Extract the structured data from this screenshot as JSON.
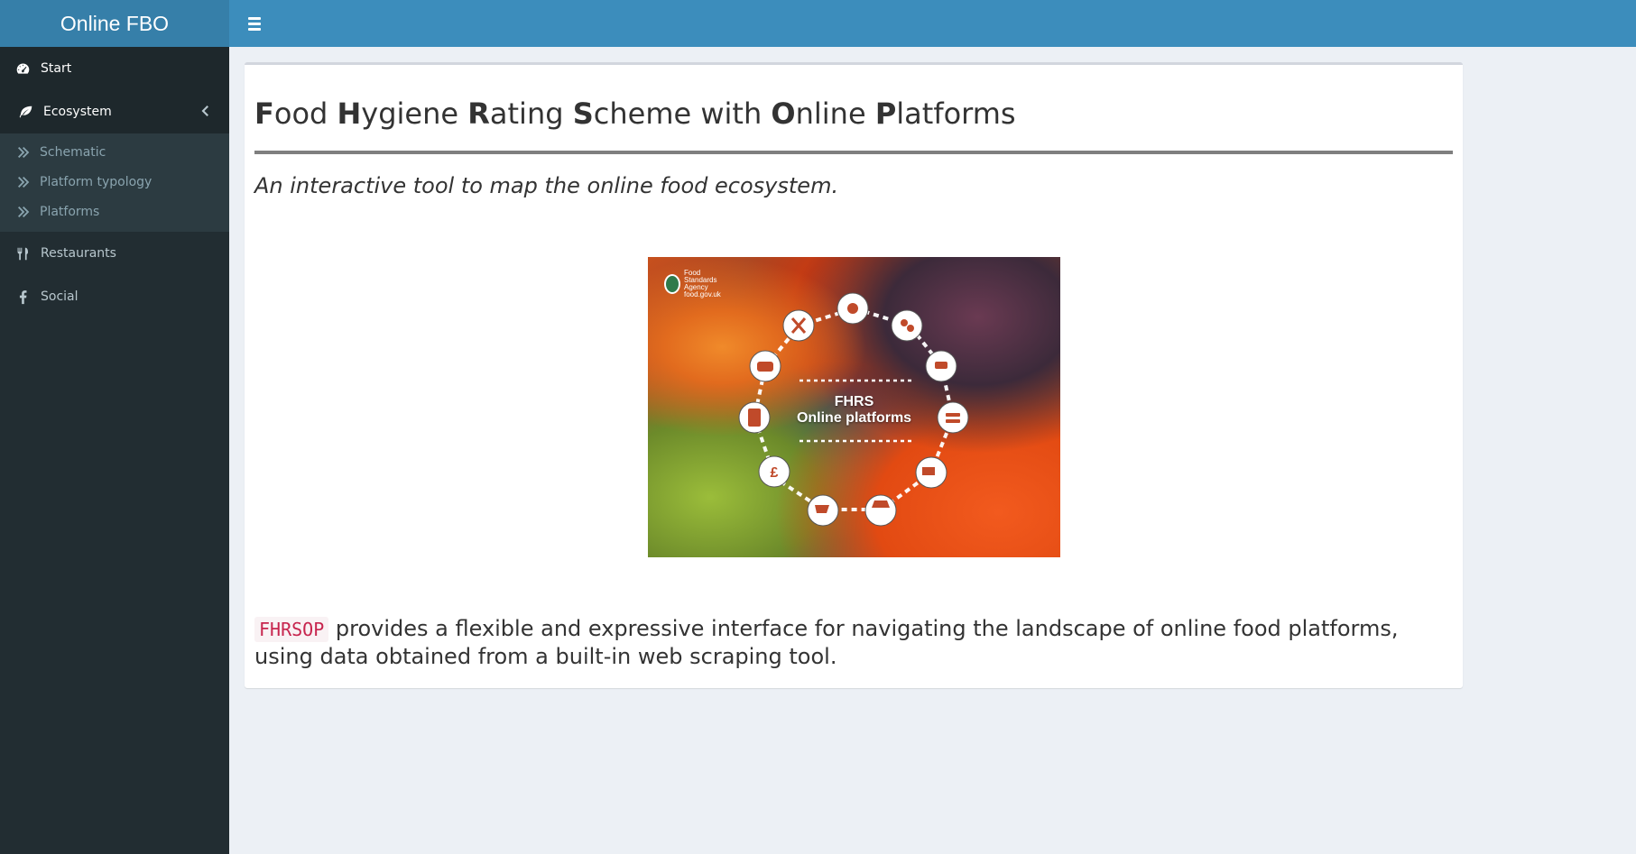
{
  "app": {
    "title": "Online FBO"
  },
  "sidebar": {
    "items": [
      {
        "label": "Start",
        "icon": "dashboard-icon",
        "active": true
      },
      {
        "label": "Ecosystem",
        "icon": "leaf-icon",
        "expanded": true,
        "children": [
          {
            "label": "Schematic"
          },
          {
            "label": "Platform typology"
          },
          {
            "label": "Platforms"
          }
        ]
      },
      {
        "label": "Restaurants",
        "icon": "cutlery-icon"
      },
      {
        "label": "Social",
        "icon": "facebook-icon"
      }
    ]
  },
  "main": {
    "title_parts": [
      {
        "bold": "F",
        "rest": "ood "
      },
      {
        "bold": "H",
        "rest": "ygiene "
      },
      {
        "bold": "R",
        "rest": "ating "
      },
      {
        "bold": "S",
        "rest": "cheme with "
      },
      {
        "bold": "O",
        "rest": "nline "
      },
      {
        "bold": "P",
        "rest": "latforms"
      }
    ],
    "subtitle": "An interactive tool to map the online food ecosystem.",
    "hero": {
      "logo_lines": [
        "Food",
        "Standards",
        "Agency",
        "food.gov.uk"
      ],
      "line1": "FHRS",
      "line2": "Online platforms"
    },
    "description": {
      "code": "FHRSOP",
      "text": " provides a flexible and expressive interface for navigating the landscape of online food platforms, using data obtained from a built-in web scraping tool."
    }
  },
  "colors": {
    "header": "#3c8dbc",
    "logo_bg": "#367fa9",
    "sidebar_bg": "#222d32",
    "content_bg": "#ecf0f5"
  }
}
